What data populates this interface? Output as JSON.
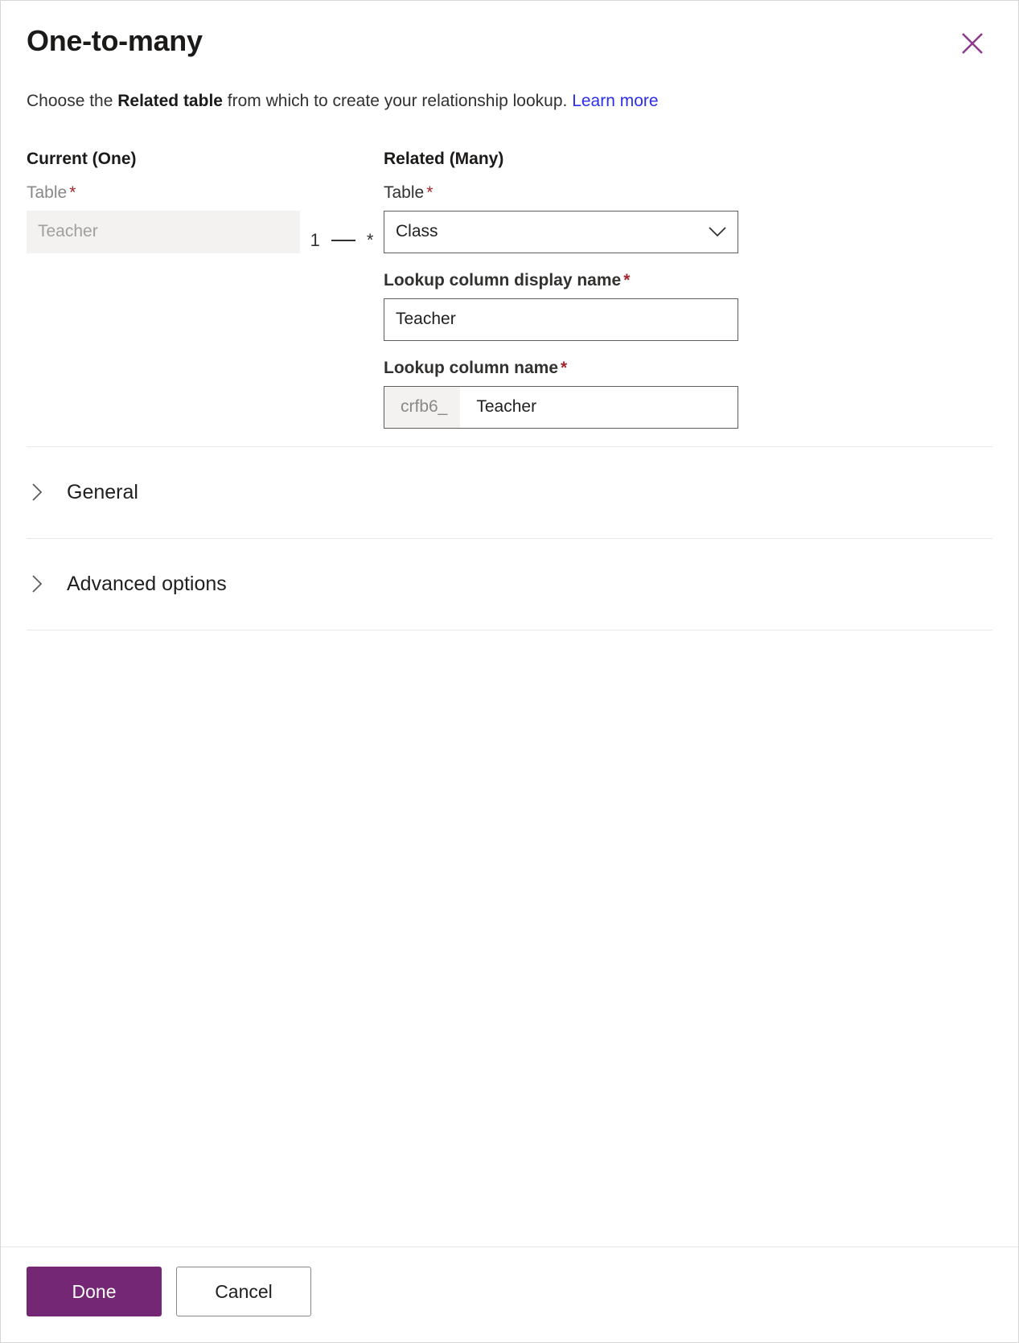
{
  "dialog": {
    "title": "One-to-many",
    "close_icon": "close-icon",
    "description_prefix": "Choose the ",
    "description_bold": "Related table",
    "description_suffix": " from which to create your relationship lookup. ",
    "learn_more": "Learn more",
    "link_color": "#2b30e8"
  },
  "current": {
    "group_title": "Current (One)",
    "table_label": "Table",
    "table_required": "*",
    "table_value": "Teacher"
  },
  "cardinality": {
    "one": "1",
    "many": "*"
  },
  "related": {
    "group_title": "Related (Many)",
    "table_label": "Table",
    "table_required": "*",
    "table_value": "Class",
    "table_chevron": "chevron-down-icon",
    "display_name_label": "Lookup column display name",
    "display_name_required": "*",
    "display_name_value": "Teacher",
    "column_name_label": "Lookup column name",
    "column_name_required": "*",
    "column_name_prefix": "crfb6_",
    "column_name_value": "Teacher"
  },
  "sections": [
    {
      "label": "General",
      "expanded": false,
      "icon": "chevron-right-icon"
    },
    {
      "label": "Advanced options",
      "expanded": false,
      "icon": "chevron-right-icon"
    }
  ],
  "footer": {
    "done_label": "Done",
    "cancel_label": "Cancel",
    "primary_color": "#742774"
  }
}
